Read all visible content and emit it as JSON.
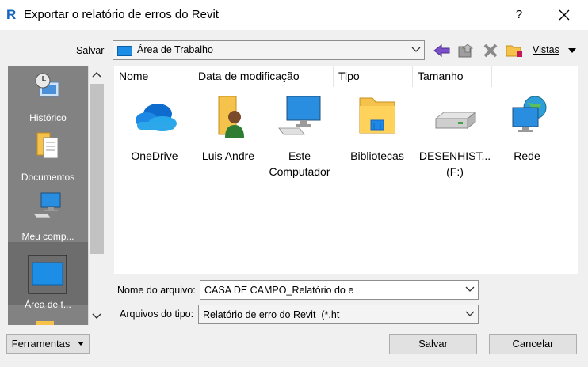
{
  "window": {
    "title": "Exportar o relatório de erros do Revit",
    "app_icon_letter": "R",
    "help_label": "?"
  },
  "save_in": {
    "label": "Salvar",
    "value": "Área de Trabalho"
  },
  "toolbar": {
    "vistas_label": "Vistas",
    "icons": [
      "back-icon",
      "up-folder-icon",
      "delete-icon",
      "new-folder-icon"
    ]
  },
  "places": [
    {
      "label": "Histórico",
      "icon": "history-icon"
    },
    {
      "label": "Documentos",
      "icon": "documents-icon"
    },
    {
      "label": "Meu comp...",
      "icon": "computer-icon"
    },
    {
      "label": "Área de t...",
      "icon": "desktop-icon",
      "selected": true
    }
  ],
  "columns": [
    "Nome",
    "Data de modificação",
    "Tipo",
    "Tamanho"
  ],
  "items": [
    {
      "name": "OneDrive",
      "icon": "onedrive-icon"
    },
    {
      "name": "Luis Andre",
      "icon": "user-folder-icon"
    },
    {
      "name": "Este Computador",
      "icon": "this-pc-icon"
    },
    {
      "name": "Bibliotecas",
      "icon": "libraries-icon"
    },
    {
      "name": "DESENHIST... (F:)",
      "icon": "drive-icon"
    },
    {
      "name": "Rede",
      "icon": "network-icon"
    }
  ],
  "file_name": {
    "label": "Nome do arquivo:",
    "value": "CASA DE CAMPO_Relatório do e"
  },
  "file_type": {
    "label": "Arquivos do tipo:",
    "value": "Relatório de erro do Revit  (*.ht"
  },
  "buttons": {
    "tools": "Ferramentas",
    "save": "Salvar",
    "cancel": "Cancelar"
  },
  "colors": {
    "accent_blue": "#1c8ee6",
    "places_bg": "#828282",
    "dialog_bg": "#f0f0f0"
  }
}
